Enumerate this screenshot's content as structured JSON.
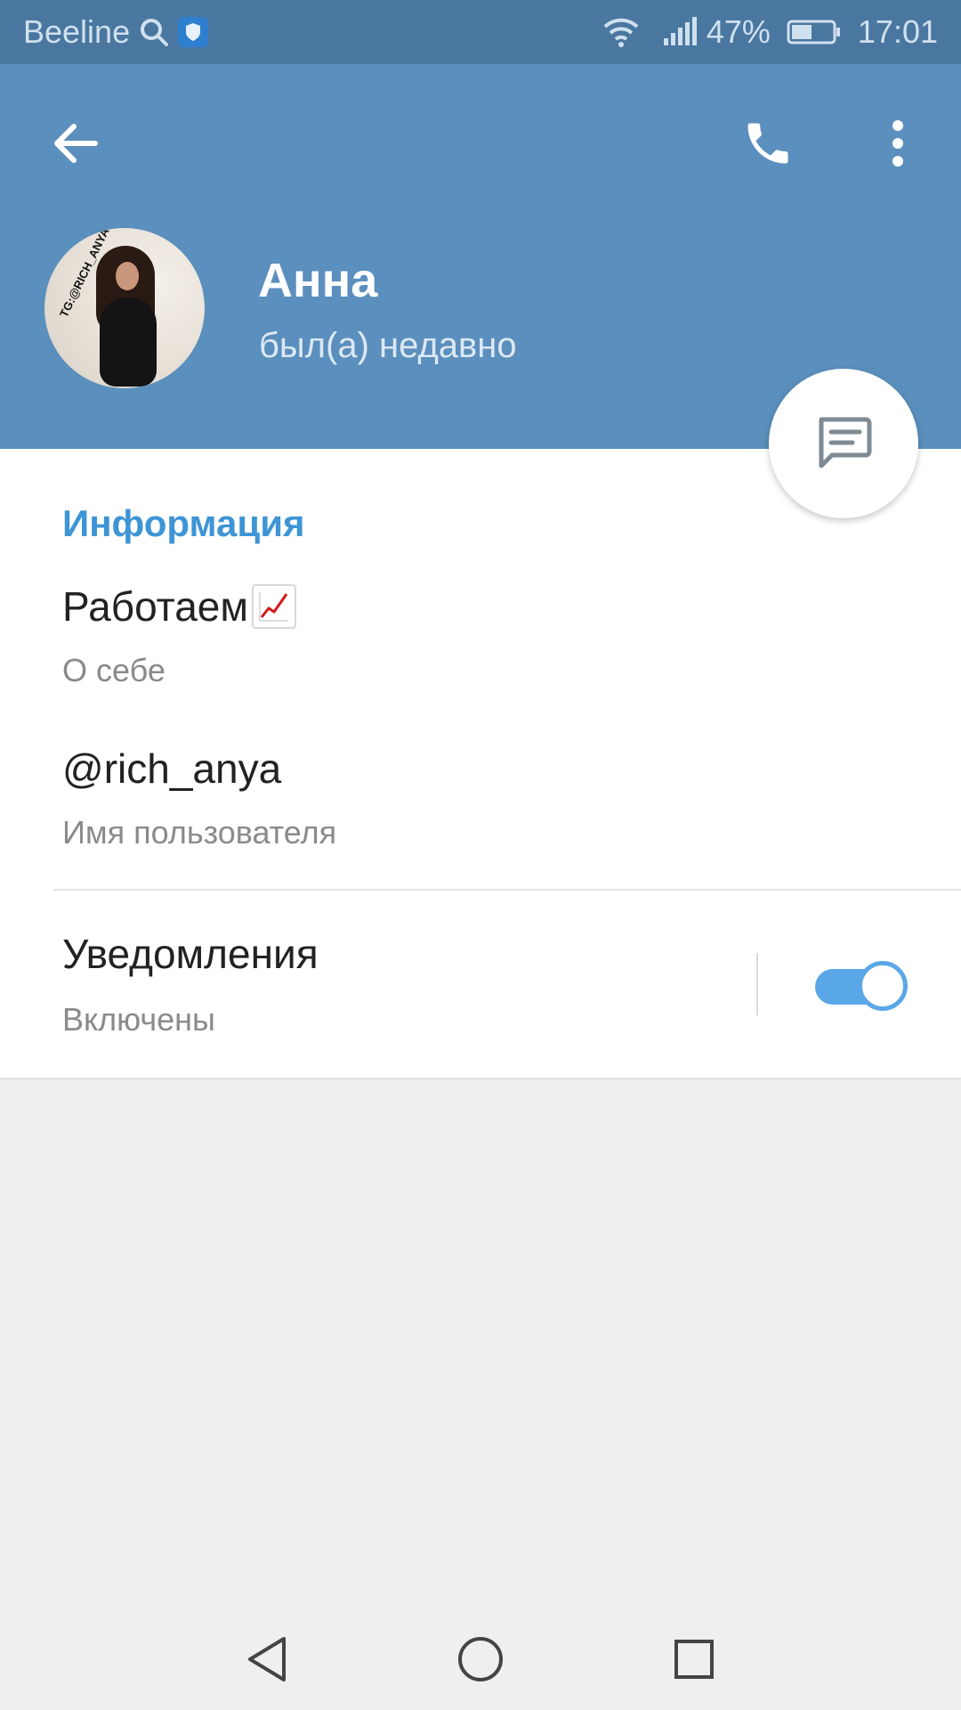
{
  "status_bar": {
    "carrier": "Beeline",
    "battery_percent": "47%",
    "time": "17:01",
    "icons": [
      "search-icon",
      "shield-icon",
      "wifi-icon",
      "signal-icon",
      "battery-icon"
    ]
  },
  "header": {
    "name": "Анна",
    "status": "был(а) недавно",
    "avatar_watermark": "TG:@RICH_ANYA",
    "colors": {
      "header_bg": "#5b8fbd",
      "status_bar_bg": "#4a77a0"
    },
    "icons": [
      "arrow-back-icon",
      "phone-icon",
      "more-vertical-icon",
      "message-icon"
    ]
  },
  "info": {
    "section_title": "Информация",
    "bio_value": "Работаем",
    "bio_label": "О себе",
    "username_value": "@rich_anya",
    "username_label": "Имя пользователя",
    "notifications_value": "Уведомления",
    "notifications_label": "Включены",
    "notifications_enabled": true,
    "accent_color": "#3d95d6"
  },
  "nav_bar": {
    "icons": [
      "nav-back-icon",
      "nav-home-icon",
      "nav-recent-icon"
    ]
  }
}
